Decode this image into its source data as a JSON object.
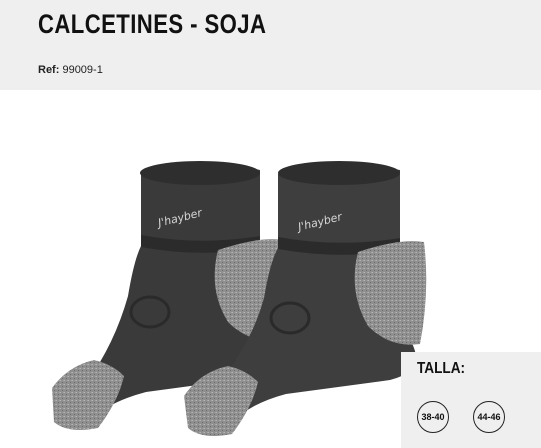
{
  "product": {
    "title": "CALCETINES - SOJA",
    "ref_label": "Ref:",
    "ref_value": "99009-1",
    "brand_logo_text": "J'hayber"
  },
  "sizes": {
    "heading": "TALLA:",
    "options": [
      "38-40",
      "44-46"
    ]
  },
  "colors": {
    "header_bg": "#efefef",
    "sock_dark": "#3a3a3a",
    "sock_heather": "#8f8f8f"
  }
}
